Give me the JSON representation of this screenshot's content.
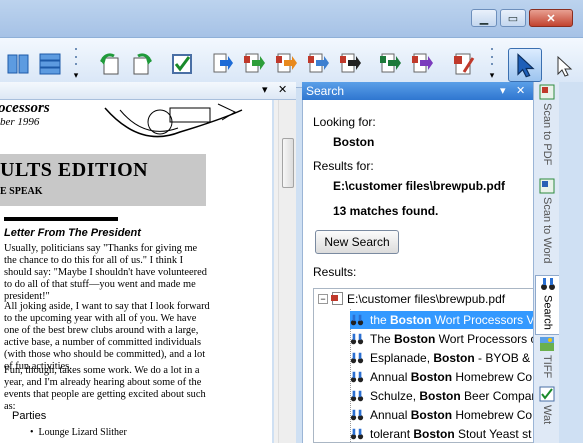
{
  "toolbar": {
    "dropdown_glyph": "▾"
  },
  "document": {
    "header_line1": "ocessors",
    "header_line2": "ber 1996",
    "banner_title": "ULTS EDITION",
    "banner_sub": "E SPEAK",
    "letter_title": "Letter From The President",
    "para1": "Usually, politicians say \"Thanks for giving me the chance to do this for all of us.\" I think I should say: \"Maybe I shouldn't have volunteered to do all of that stuff—you went and made me president!\"",
    "para2": "All joking aside, I want to say that I look forward to the upcoming year with all of you. We have one of the best brew clubs around with a large, active base, a number of committed individuals (with those who should be committed), and a lot of fun activities.",
    "para3": "Fun, though, takes some work. We do a lot in a year, and I'm already hearing about some of the events that people are getting excited about such as:",
    "parties": "Parties",
    "lounge": "Lounge Lizard Slither"
  },
  "search_panel": {
    "title": "Search",
    "looking_for_label": "Looking for:",
    "looking_for_value": "Boston",
    "results_for_label": "Results for:",
    "results_for_value": "E:\\customer files\\brewpub.pdf",
    "matches": "13 matches found.",
    "new_search_button": "New Search",
    "results_label": "Results:",
    "tree_root": "E:\\customer files\\brewpub.pdf",
    "results": [
      {
        "pre": "the ",
        "bold": "Boston",
        "post": " Wort Processors V",
        "selected": true
      },
      {
        "pre": "The ",
        "bold": "Boston",
        "post": " Wort Processors o",
        "selected": false
      },
      {
        "pre": "Esplanade, ",
        "bold": "Boston",
        "post": " - BYOB & I",
        "selected": false
      },
      {
        "pre": "Annual ",
        "bold": "Boston",
        "post": " Homebrew Co",
        "selected": false
      },
      {
        "pre": "Schulze, ",
        "bold": "Boston",
        "post": " Beer Compar",
        "selected": false
      },
      {
        "pre": "Annual ",
        "bold": "Boston",
        "post": " Homebrew Co",
        "selected": false
      },
      {
        "pre": "tolerant ",
        "bold": "Boston",
        "post": " Stout Yeast st",
        "selected": false
      }
    ]
  },
  "side_tabs": [
    {
      "label": "Scan to PDF",
      "icon": "scan-pdf-icon"
    },
    {
      "label": "Scan to Word",
      "icon": "scan-word-icon"
    },
    {
      "label": "Search",
      "icon": "binoculars-icon",
      "active": true
    },
    {
      "label": "TIFF",
      "icon": "tiff-image-icon"
    },
    {
      "label": "Wat",
      "icon": "checklist-icon"
    }
  ],
  "colors": {
    "selection": "#3399ff",
    "panel_header": "#2f76d0"
  }
}
